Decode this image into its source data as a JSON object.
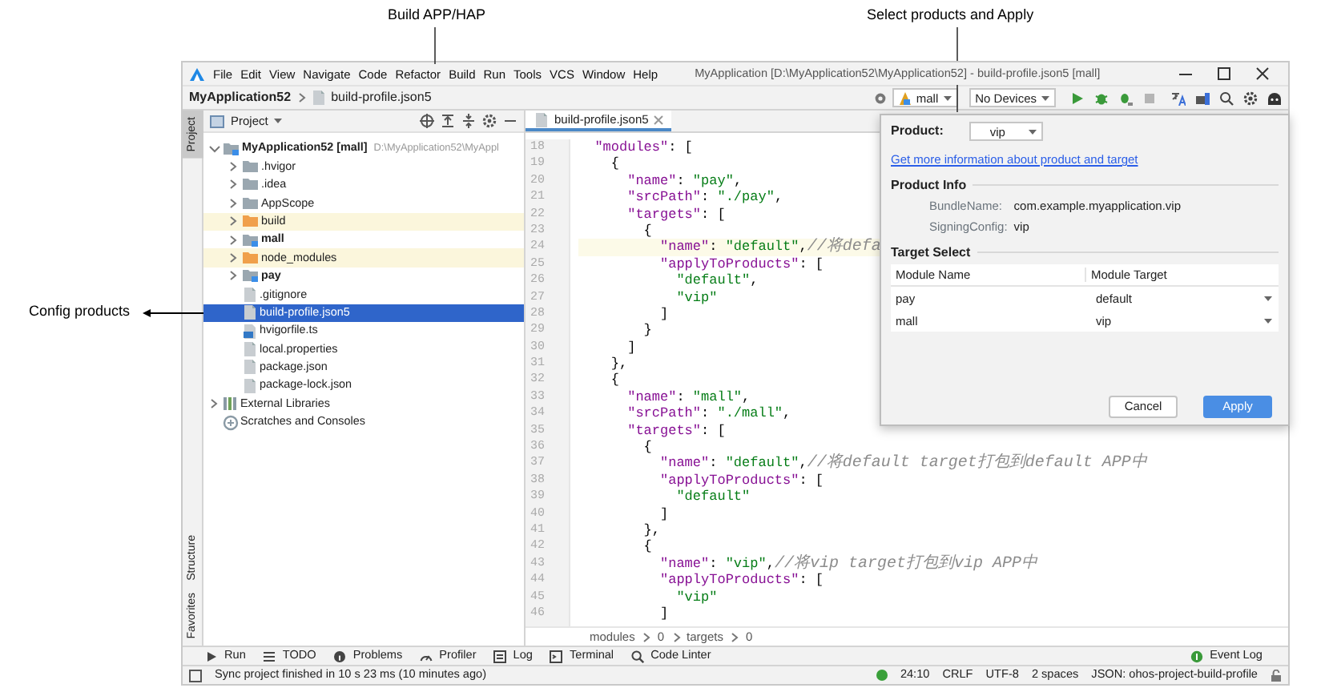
{
  "callouts": [
    {
      "text": "Build APP/HAP"
    },
    {
      "text": "Select products and Apply"
    },
    {
      "text": "Config products"
    }
  ],
  "window": {
    "title": "MyApplication [D:\\MyApplication52\\MyApplication52] - build-profile.json5 [mall]"
  },
  "menu": [
    "File",
    "Edit",
    "View",
    "Navigate",
    "Code",
    "Refactor",
    "Build",
    "Run",
    "Tools",
    "VCS",
    "Window",
    "Help"
  ],
  "navbar": {
    "project": "MyApplication52",
    "file": "build-profile.json5"
  },
  "toolbar": {
    "module": "mall",
    "device": "No Devices"
  },
  "side_tabs": [
    {
      "label": "Project",
      "selected": true
    },
    {
      "label": "Structure",
      "selected": false
    },
    {
      "label": "Favorites",
      "selected": false
    }
  ],
  "project_panel": {
    "title": "Project",
    "tree": [
      {
        "label": "MyApplication52 [mall]",
        "path": "D:\\MyApplication52\\MyAppl",
        "kind": "project",
        "expanded": true,
        "selected": false,
        "children": [
          {
            "label": ".hvigor",
            "kind": "folder",
            "expanded": false,
            "selected": false
          },
          {
            "label": ".idea",
            "kind": "folder",
            "expanded": false,
            "selected": false
          },
          {
            "label": "AppScope",
            "kind": "folder",
            "expanded": false,
            "selected": false
          },
          {
            "label": "build",
            "kind": "excluded",
            "expanded": false,
            "selected": false
          },
          {
            "label": "mall",
            "kind": "module",
            "expanded": false,
            "selected": false
          },
          {
            "label": "node_modules",
            "kind": "excluded",
            "expanded": false,
            "selected": false
          },
          {
            "label": "pay",
            "kind": "module",
            "expanded": false,
            "selected": false
          },
          {
            "label": ".gitignore",
            "kind": "file",
            "selected": false
          },
          {
            "label": "build-profile.json5",
            "kind": "file",
            "selected": true
          },
          {
            "label": "hvigorfile.ts",
            "kind": "ts",
            "selected": false
          },
          {
            "label": "local.properties",
            "kind": "file",
            "selected": false
          },
          {
            "label": "package.json",
            "kind": "file",
            "selected": false
          },
          {
            "label": "package-lock.json",
            "kind": "file",
            "selected": false
          }
        ]
      },
      {
        "label": "External Libraries",
        "kind": "library",
        "expanded": false,
        "selected": false
      },
      {
        "label": "Scratches and Consoles",
        "kind": "scratches",
        "selected": false
      }
    ]
  },
  "editor": {
    "tab": "build-profile.json5",
    "lines": [
      {
        "number": "18",
        "current": false,
        "tokens": [
          {
            "kind": "key",
            "text": "  \"modules\""
          },
          {
            "kind": "punct",
            "text": ": ["
          }
        ]
      },
      {
        "number": "19",
        "current": false,
        "tokens": [
          {
            "kind": "punct",
            "text": "    {"
          }
        ]
      },
      {
        "number": "20",
        "current": false,
        "tokens": [
          {
            "kind": "key",
            "text": "      \"name\""
          },
          {
            "kind": "punct",
            "text": ": "
          },
          {
            "kind": "string",
            "text": "\"pay\""
          },
          {
            "kind": "punct",
            "text": ","
          }
        ]
      },
      {
        "number": "21",
        "current": false,
        "tokens": [
          {
            "kind": "key",
            "text": "      \"srcPath\""
          },
          {
            "kind": "punct",
            "text": ": "
          },
          {
            "kind": "string",
            "text": "\"./pay\""
          },
          {
            "kind": "punct",
            "text": ","
          }
        ]
      },
      {
        "number": "22",
        "current": false,
        "tokens": [
          {
            "kind": "key",
            "text": "      \"targets\""
          },
          {
            "kind": "punct",
            "text": ": ["
          }
        ]
      },
      {
        "number": "23",
        "current": false,
        "tokens": [
          {
            "kind": "punct",
            "text": "        {"
          }
        ]
      },
      {
        "number": "24",
        "current": true,
        "tokens": [
          {
            "kind": "key",
            "text": "          \"name\""
          },
          {
            "kind": "punct",
            "text": ": "
          },
          {
            "kind": "string",
            "text": "\"default\""
          },
          {
            "kind": "punct",
            "text": ","
          },
          {
            "kind": "comment",
            "text": "//将defa"
          }
        ]
      },
      {
        "number": "25",
        "current": false,
        "tokens": [
          {
            "kind": "key",
            "text": "          \"applyToProducts\""
          },
          {
            "kind": "punct",
            "text": ": ["
          }
        ]
      },
      {
        "number": "26",
        "current": false,
        "tokens": [
          {
            "kind": "string",
            "text": "            \"default\""
          },
          {
            "kind": "punct",
            "text": ","
          }
        ]
      },
      {
        "number": "27",
        "current": false,
        "tokens": [
          {
            "kind": "string",
            "text": "            \"vip\""
          }
        ]
      },
      {
        "number": "28",
        "current": false,
        "tokens": [
          {
            "kind": "punct",
            "text": "          ]"
          }
        ]
      },
      {
        "number": "29",
        "current": false,
        "tokens": [
          {
            "kind": "punct",
            "text": "        }"
          }
        ]
      },
      {
        "number": "30",
        "current": false,
        "tokens": [
          {
            "kind": "punct",
            "text": "      ]"
          }
        ]
      },
      {
        "number": "31",
        "current": false,
        "tokens": [
          {
            "kind": "punct",
            "text": "    },"
          }
        ]
      },
      {
        "number": "32",
        "current": false,
        "tokens": [
          {
            "kind": "punct",
            "text": "    {"
          }
        ]
      },
      {
        "number": "33",
        "current": false,
        "tokens": [
          {
            "kind": "key",
            "text": "      \"name\""
          },
          {
            "kind": "punct",
            "text": ": "
          },
          {
            "kind": "string",
            "text": "\"mall\""
          },
          {
            "kind": "punct",
            "text": ","
          }
        ]
      },
      {
        "number": "34",
        "current": false,
        "tokens": [
          {
            "kind": "key",
            "text": "      \"srcPath\""
          },
          {
            "kind": "punct",
            "text": ": "
          },
          {
            "kind": "string",
            "text": "\"./mall\""
          },
          {
            "kind": "punct",
            "text": ","
          }
        ]
      },
      {
        "number": "35",
        "current": false,
        "tokens": [
          {
            "kind": "key",
            "text": "      \"targets\""
          },
          {
            "kind": "punct",
            "text": ": ["
          }
        ]
      },
      {
        "number": "36",
        "current": false,
        "tokens": [
          {
            "kind": "punct",
            "text": "        {"
          }
        ]
      },
      {
        "number": "37",
        "current": false,
        "tokens": [
          {
            "kind": "key",
            "text": "          \"name\""
          },
          {
            "kind": "punct",
            "text": ": "
          },
          {
            "kind": "string",
            "text": "\"default\""
          },
          {
            "kind": "punct",
            "text": ","
          },
          {
            "kind": "comment",
            "text": "//将default target打包到default APP中"
          }
        ]
      },
      {
        "number": "38",
        "current": false,
        "tokens": [
          {
            "kind": "key",
            "text": "          \"applyToProducts\""
          },
          {
            "kind": "punct",
            "text": ": ["
          }
        ]
      },
      {
        "number": "39",
        "current": false,
        "tokens": [
          {
            "kind": "string",
            "text": "            \"default\""
          }
        ]
      },
      {
        "number": "40",
        "current": false,
        "tokens": [
          {
            "kind": "punct",
            "text": "          ]"
          }
        ]
      },
      {
        "number": "41",
        "current": false,
        "tokens": [
          {
            "kind": "punct",
            "text": "        },"
          }
        ]
      },
      {
        "number": "42",
        "current": false,
        "tokens": [
          {
            "kind": "punct",
            "text": "        {"
          }
        ]
      },
      {
        "number": "43",
        "current": false,
        "tokens": [
          {
            "kind": "key",
            "text": "          \"name\""
          },
          {
            "kind": "punct",
            "text": ": "
          },
          {
            "kind": "string",
            "text": "\"vip\""
          },
          {
            "kind": "punct",
            "text": ","
          },
          {
            "kind": "comment",
            "text": "//将vip target打包到vip APP中"
          }
        ]
      },
      {
        "number": "44",
        "current": false,
        "tokens": [
          {
            "kind": "key",
            "text": "          \"applyToProducts\""
          },
          {
            "kind": "punct",
            "text": ": ["
          }
        ]
      },
      {
        "number": "45",
        "current": false,
        "tokens": [
          {
            "kind": "string",
            "text": "            \"vip\""
          }
        ]
      },
      {
        "number": "46",
        "current": false,
        "tokens": [
          {
            "kind": "punct",
            "text": "          ]"
          }
        ]
      }
    ],
    "breadcrumb": [
      "modules",
      "0",
      "targets",
      "0"
    ]
  },
  "dialog": {
    "product_label": "Product:",
    "product": "vip",
    "link": "Get more information about product and target",
    "info_title": "Product Info",
    "info": [
      {
        "label": "BundleName:",
        "value": "com.example.myapplication.vip"
      },
      {
        "label": "SigningConfig:",
        "value": "vip"
      }
    ],
    "target_title": "Target Select",
    "columns": [
      "Module Name",
      "Module Target"
    ],
    "rows": [
      {
        "module": "pay",
        "target": "default"
      },
      {
        "module": "mall",
        "target": "vip"
      }
    ],
    "buttons": [
      {
        "label": "Cancel",
        "primary": false
      },
      {
        "label": "Apply",
        "primary": true
      }
    ]
  },
  "tool_tabs": [
    "Run",
    "TODO",
    "Problems",
    "Profiler",
    "Log",
    "Terminal",
    "Code Linter"
  ],
  "event_log": "Event Log",
  "status": {
    "message": "Sync project finished in 10 s 23 ms (10 minutes ago)",
    "items": [
      "24:10",
      "CRLF",
      "UTF-8",
      "2 spaces",
      "JSON: ohos-project-build-profile"
    ]
  }
}
